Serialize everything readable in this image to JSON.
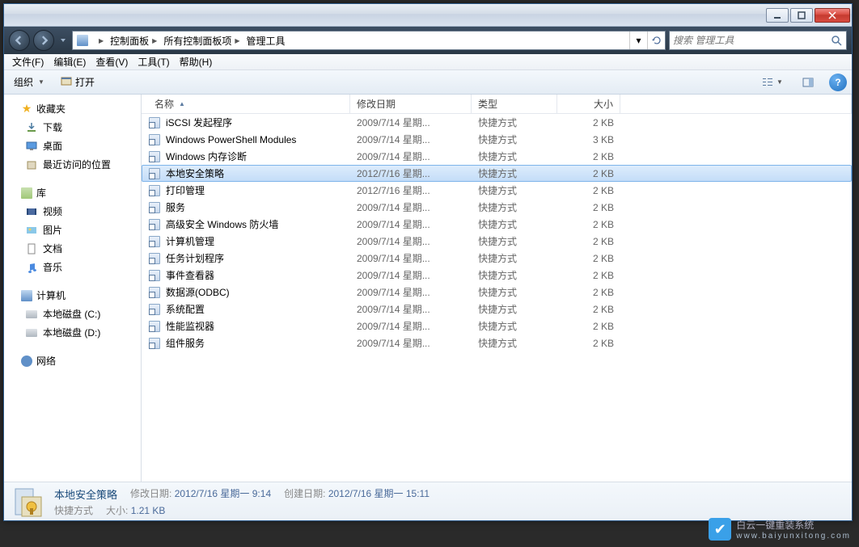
{
  "titlebar": {},
  "breadcrumb": [
    "控制面板",
    "所有控制面板项",
    "管理工具"
  ],
  "search": {
    "placeholder": "搜索 管理工具"
  },
  "menubar": [
    "文件(F)",
    "编辑(E)",
    "查看(V)",
    "工具(T)",
    "帮助(H)"
  ],
  "toolbar": {
    "organize": "组织",
    "open": "打开"
  },
  "nav": {
    "favorites": {
      "label": "收藏夹",
      "items": [
        "下载",
        "桌面",
        "最近访问的位置"
      ]
    },
    "library": {
      "label": "库",
      "items": [
        "视频",
        "图片",
        "文档",
        "音乐"
      ]
    },
    "computer": {
      "label": "计算机",
      "items": [
        "本地磁盘 (C:)",
        "本地磁盘 (D:)"
      ]
    },
    "network": {
      "label": "网络"
    }
  },
  "columns": {
    "name": "名称",
    "date": "修改日期",
    "type": "类型",
    "size": "大小"
  },
  "rows": [
    {
      "name": "iSCSI 发起程序",
      "date": "2009/7/14 星期...",
      "type": "快捷方式",
      "size": "2 KB",
      "sel": false
    },
    {
      "name": "Windows PowerShell Modules",
      "date": "2009/7/14 星期...",
      "type": "快捷方式",
      "size": "3 KB",
      "sel": false
    },
    {
      "name": "Windows 内存诊断",
      "date": "2009/7/14 星期...",
      "type": "快捷方式",
      "size": "2 KB",
      "sel": false
    },
    {
      "name": "本地安全策略",
      "date": "2012/7/16 星期...",
      "type": "快捷方式",
      "size": "2 KB",
      "sel": true
    },
    {
      "name": "打印管理",
      "date": "2012/7/16 星期...",
      "type": "快捷方式",
      "size": "2 KB",
      "sel": false
    },
    {
      "name": "服务",
      "date": "2009/7/14 星期...",
      "type": "快捷方式",
      "size": "2 KB",
      "sel": false
    },
    {
      "name": "高级安全 Windows 防火墙",
      "date": "2009/7/14 星期...",
      "type": "快捷方式",
      "size": "2 KB",
      "sel": false
    },
    {
      "name": "计算机管理",
      "date": "2009/7/14 星期...",
      "type": "快捷方式",
      "size": "2 KB",
      "sel": false
    },
    {
      "name": "任务计划程序",
      "date": "2009/7/14 星期...",
      "type": "快捷方式",
      "size": "2 KB",
      "sel": false
    },
    {
      "name": "事件查看器",
      "date": "2009/7/14 星期...",
      "type": "快捷方式",
      "size": "2 KB",
      "sel": false
    },
    {
      "name": "数据源(ODBC)",
      "date": "2009/7/14 星期...",
      "type": "快捷方式",
      "size": "2 KB",
      "sel": false
    },
    {
      "name": "系统配置",
      "date": "2009/7/14 星期...",
      "type": "快捷方式",
      "size": "2 KB",
      "sel": false
    },
    {
      "name": "性能监视器",
      "date": "2009/7/14 星期...",
      "type": "快捷方式",
      "size": "2 KB",
      "sel": false
    },
    {
      "name": "组件服务",
      "date": "2009/7/14 星期...",
      "type": "快捷方式",
      "size": "2 KB",
      "sel": false
    }
  ],
  "details": {
    "name": "本地安全策略",
    "modLabel": "修改日期:",
    "modVal": "2012/7/16 星期一 9:14",
    "createLabel": "创建日期:",
    "createVal": "2012/7/16 星期一 15:11",
    "typeVal": "快捷方式",
    "sizeLabel": "大小:",
    "sizeVal": "1.21 KB"
  },
  "watermark": {
    "text": "白云一键重装系统",
    "url": "www.baiyunxitong.com"
  }
}
